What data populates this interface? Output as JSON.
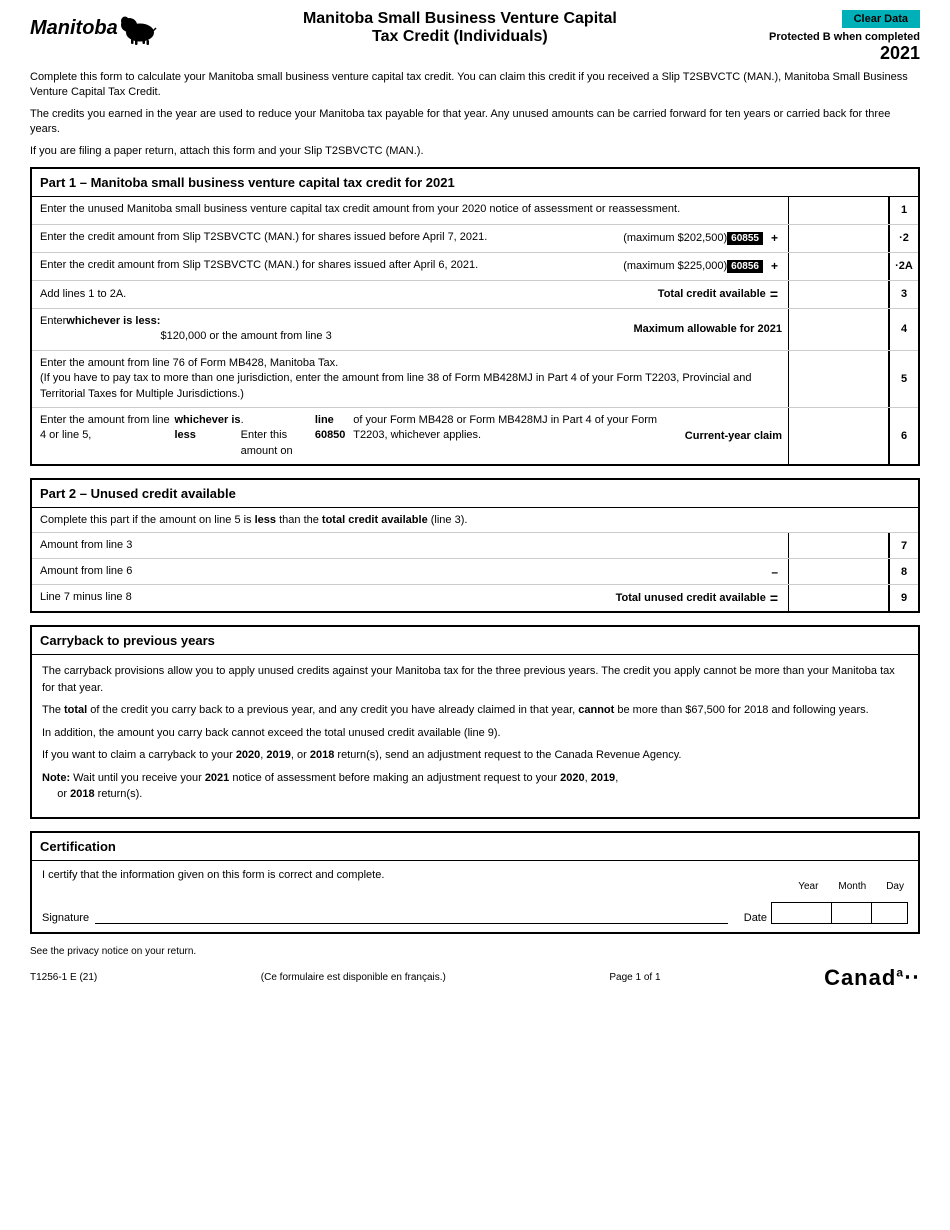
{
  "header": {
    "clear_data_label": "Clear Data",
    "protected_label": "Protected B when completed",
    "year": "2021",
    "form_title_line1": "Manitoba Small Business Venture Capital",
    "form_title_line2": "Tax Credit (Individuals)"
  },
  "intro": {
    "para1": "Complete this form to calculate your Manitoba small business venture capital tax credit. You can claim this credit if you received a Slip T2SBVCTC (MAN.), Manitoba Small Business Venture Capital Tax Credit.",
    "para2": "The credits you earned in the year are used to reduce your Manitoba tax payable for that year. Any unused amounts can be carried forward for ten years or carried back for three years.",
    "para3": "If you are filing a paper return, attach this form and your Slip T2SBVCTC (MAN.)."
  },
  "part1": {
    "title": "Part 1 – Manitoba small business venture capital tax credit for 2021",
    "rows": [
      {
        "label": "Enter the unused Manitoba small business venture capital tax credit amount from your 2020 notice of assessment or reassessment.",
        "middle": "",
        "line": "1"
      },
      {
        "label": "Enter the credit amount from Slip T2SBVCTC (MAN.) for shares issued before April 7, 2021.",
        "middle": "(maximum $202,500)",
        "badge": "60855",
        "operator": "+",
        "line": "·2"
      },
      {
        "label": "Enter the credit amount from Slip T2SBVCTC (MAN.) for shares issued after April 6, 2021.",
        "middle": "(maximum $225,000)",
        "badge": "60856",
        "operator": "+",
        "line": "·2A"
      },
      {
        "label": "Add lines 1 to 2A.",
        "middle_bold": "Total credit available",
        "operator": "=",
        "line": "3"
      },
      {
        "label": "Enter whichever is less:\n$120,000 or the amount from line 3",
        "middle_bold": "Maximum allowable for 2021",
        "line": "4"
      },
      {
        "label": "Enter the amount from line 76 of Form MB428, Manitoba Tax.\n(If you have to pay tax to more than one jurisdiction, enter the amount from line 38 of Form MB428MJ in Part 4 of your Form T2203, Provincial and Territorial Taxes for Multiple Jurisdictions.)",
        "line": "5"
      },
      {
        "label": "Enter the amount from line 4 or line 5, whichever is less.\nEnter this amount on line 60850 of your Form MB428 or Form MB428MJ in Part 4 of your Form T2203, whichever applies.",
        "middle_bold": "Current-year claim",
        "line": "6"
      }
    ]
  },
  "part2": {
    "title": "Part 2 – Unused credit available",
    "intro": "Complete this part if the amount on line 5 is less than the total credit available (line 3).",
    "rows": [
      {
        "label": "Amount from line 3",
        "operator": "",
        "line": "7"
      },
      {
        "label": "Amount from line 6",
        "operator": "–",
        "line": "8"
      },
      {
        "label": "Line 7 minus line 8",
        "middle_bold": "Total unused credit available",
        "operator": "=",
        "line": "9"
      }
    ]
  },
  "carryback": {
    "title": "Carryback to previous years",
    "para1": "The carryback provisions allow you to apply unused credits against your Manitoba tax for the three previous years. The credit you apply cannot be more than your Manitoba tax for that year.",
    "para2": "The total of the credit you carry back to a previous year, and any credit you have already claimed in that year, cannot be more than $67,500 for 2018 and following years.",
    "para3": "In addition, the amount you carry back cannot exceed the total unused credit available (line 9).",
    "para4": "If you want to claim a carryback to your 2020, 2019, or 2018 return(s), send an adjustment request to the Canada Revenue Agency.",
    "note": "Note: Wait until you receive your 2021 notice of assessment before making an adjustment request to your 2020, 2019, or 2018 return(s)."
  },
  "certification": {
    "title": "Certification",
    "statement": "I certify that the information given on this form is correct and complete.",
    "signature_label": "Signature",
    "date_label": "Date",
    "year_label": "Year",
    "month_label": "Month",
    "day_label": "Day"
  },
  "footer": {
    "form_number": "T1256-1 E (21)",
    "french_note": "(Ce formulaire est disponible en français.)",
    "page_info": "Page 1 of 1",
    "privacy_note": "See the privacy notice on your return.",
    "canada_label": "Canad"
  }
}
